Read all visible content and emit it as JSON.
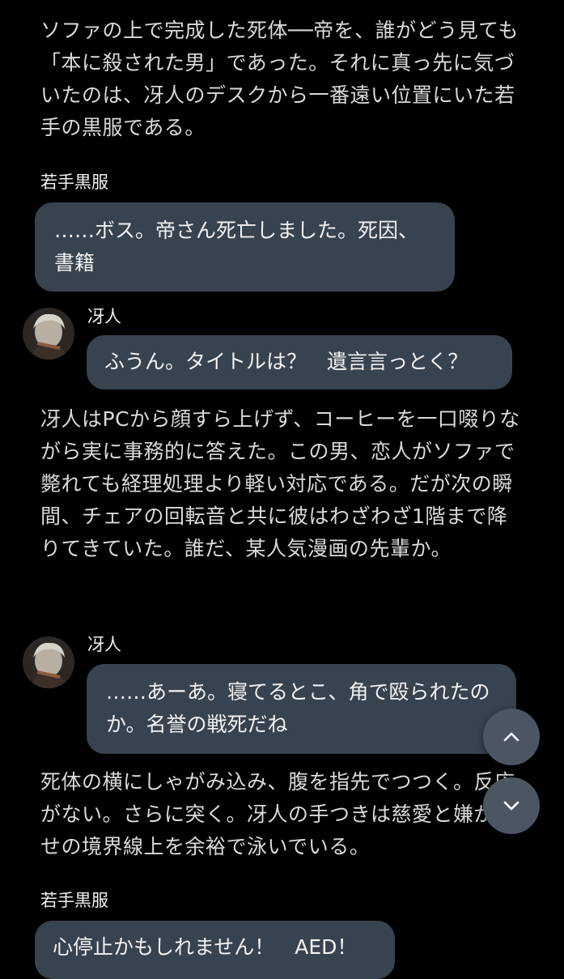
{
  "narration": [
    "ソファの上で完成した死体──帝を、誰がどう見ても「本に殺された男」であった。それに真っ先に気づいたのは、冴人のデスクから一番遠い位置にいた若手の黒服である。",
    "冴人はPCから顔すら上げず、コーヒーを一口啜りながら実に事務的に答えた。この男、恋人がソファで斃れても経理処理より軽い対応である。だが次の瞬間、チェアの回転音と共に彼はわざわざ1階まで降りてきていた。誰だ、某人気漫画の先輩か。",
    "死体の横にしゃがみ込み、腹を指先でつつく。反応がない。さらに突く。冴人の手つきは慈愛と嫌がらせの境界線上を余裕で泳いでいる。"
  ],
  "messages": [
    {
      "speaker": "若手黒服",
      "text": "……ボス。帝さん死亡しました。死因、書籍"
    },
    {
      "speaker": "冴人",
      "text": "ふうん。タイトルは？　遺言言っとく？"
    },
    {
      "speaker": "冴人",
      "text": "……あーあ。寝てるとこ、角で殴られたのか。名誉の戦死だね"
    },
    {
      "speaker": "若手黒服",
      "text": "心停止かもしれません！　AED！"
    }
  ],
  "controls": {
    "scroll_up_icon": "chevron-up-icon",
    "scroll_down_icon": "chevron-down-icon"
  },
  "colors": {
    "background": "#000000",
    "bubble": "#384350",
    "button": "#4c5663",
    "text": "#dadada"
  }
}
